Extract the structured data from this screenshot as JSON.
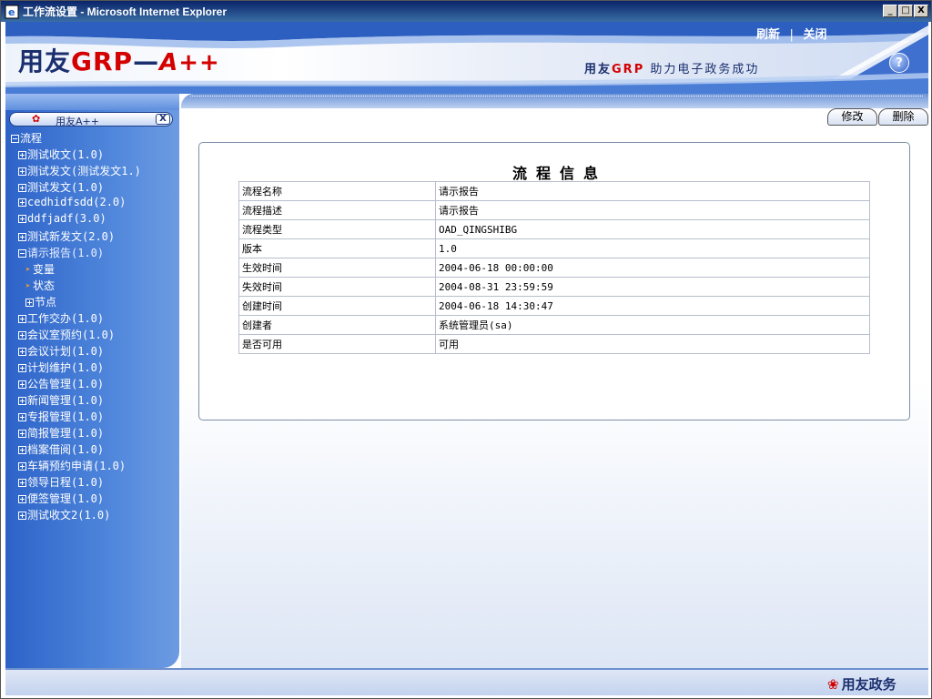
{
  "window": {
    "title": "工作流设置 - Microsoft Internet Explorer",
    "buttons": {
      "minimize": "_",
      "maximize": "□",
      "close": "X"
    }
  },
  "banner": {
    "logo": {
      "part1": "用友",
      "part2": "GRP",
      "part3": "—",
      "part4": "A++"
    },
    "slogan": {
      "brand": "用友",
      "grp": "GRP",
      "text": "助力电子政务成功"
    },
    "links": [
      "刷新",
      "关闭"
    ],
    "separator": "|",
    "help_label": "?"
  },
  "sidebar": {
    "tab_label": "用友A++",
    "tab_close": "X",
    "tree": [
      {
        "label": "流程",
        "level": 0,
        "expander": "minus"
      },
      {
        "label": "测试收文(1.0)",
        "level": 1,
        "expander": "plus"
      },
      {
        "label": "测试发文(测试发文1.)",
        "level": 1,
        "expander": "plus"
      },
      {
        "label": "测试发文(1.0)",
        "level": 1,
        "expander": "plus"
      },
      {
        "label": "cedhidfsdd(2.0)",
        "level": 1,
        "expander": "plus"
      },
      {
        "label": "ddfjadf(3.0)",
        "level": 1,
        "expander": "plus"
      },
      {
        "label": "测试新发文(2.0)",
        "level": 1,
        "expander": "plus"
      },
      {
        "label": "请示报告(1.0)",
        "level": 1,
        "expander": "minus",
        "selected": true
      },
      {
        "label": "变量",
        "level": 2,
        "expander": "arrow"
      },
      {
        "label": "状态",
        "level": 2,
        "expander": "arrow"
      },
      {
        "label": "节点",
        "level": 2,
        "expander": "plus"
      },
      {
        "label": "工作交办(1.0)",
        "level": 1,
        "expander": "plus"
      },
      {
        "label": "会议室预约(1.0)",
        "level": 1,
        "expander": "plus"
      },
      {
        "label": "会议计划(1.0)",
        "level": 1,
        "expander": "plus"
      },
      {
        "label": "计划维护(1.0)",
        "level": 1,
        "expander": "plus"
      },
      {
        "label": "公告管理(1.0)",
        "level": 1,
        "expander": "plus"
      },
      {
        "label": "新闻管理(1.0)",
        "level": 1,
        "expander": "plus"
      },
      {
        "label": "专报管理(1.0)",
        "level": 1,
        "expander": "plus"
      },
      {
        "label": "简报管理(1.0)",
        "level": 1,
        "expander": "plus"
      },
      {
        "label": "档案借阅(1.0)",
        "level": 1,
        "expander": "plus"
      },
      {
        "label": "车辆预约申请(1.0)",
        "level": 1,
        "expander": "plus"
      },
      {
        "label": "领导日程(1.0)",
        "level": 1,
        "expander": "plus"
      },
      {
        "label": "便签管理(1.0)",
        "level": 1,
        "expander": "plus"
      },
      {
        "label": "测试收文2(1.0)",
        "level": 1,
        "expander": "plus"
      }
    ]
  },
  "main": {
    "actions": {
      "edit": "修改",
      "delete": "删除"
    },
    "panel_title": "流程信息",
    "rows": [
      {
        "key": "流程名称",
        "value": "请示报告"
      },
      {
        "key": "流程描述",
        "value": "请示报告"
      },
      {
        "key": "流程类型",
        "value": "OAD_QINGSHIBG"
      },
      {
        "key": "版本",
        "value": "1.0"
      },
      {
        "key": "生效时间",
        "value": "2004-06-18 00:00:00"
      },
      {
        "key": "失效时间",
        "value": "2004-08-31 23:59:59"
      },
      {
        "key": "创建时间",
        "value": "2004-06-18 14:30:47"
      },
      {
        "key": "创建者",
        "value": "系统管理员(sa)"
      },
      {
        "key": "是否可用",
        "value": "可用"
      }
    ]
  },
  "footer": {
    "brand": "用友政务"
  },
  "colors": {
    "accent": "#2d63c8",
    "brand_red": "#d40000",
    "navy": "#1b2f6e"
  }
}
